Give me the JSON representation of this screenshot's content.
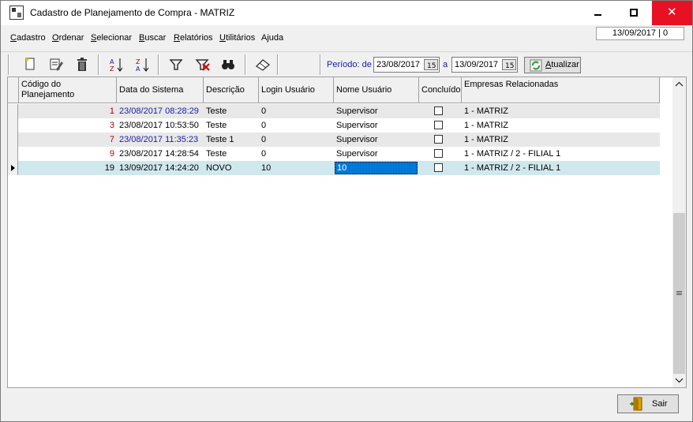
{
  "window": {
    "title": "Cadastro de Planejamento de Compra - MATRIZ",
    "icon": "app-icon",
    "close_glyph": "✕"
  },
  "menubar": {
    "items": [
      {
        "label_first": "C",
        "label_rest": "adastro"
      },
      {
        "label_first": "O",
        "label_rest": "rdenar"
      },
      {
        "label_first": "S",
        "label_rest": "elecionar"
      },
      {
        "label_first": "B",
        "label_rest": "uscar"
      },
      {
        "label_first": "R",
        "label_rest": "elatórios"
      },
      {
        "label_first": "U",
        "label_rest": "tilitários"
      },
      {
        "label_first": "",
        "label_rest": "Ajuda"
      }
    ],
    "status": "13/09/2017 | 0"
  },
  "toolbar": {
    "periodo_label": "Período: de",
    "date_from": "23/08/2017",
    "a_label": "a",
    "date_to": "13/09/2017",
    "atualizar_first": "A",
    "atualizar_rest": "tualizar"
  },
  "grid": {
    "headers": [
      "Código do Planejamento",
      "Data do Sistema",
      "Descrição",
      "Login Usuário",
      "Nome Usuário",
      "Concluído",
      "Empresas Relacionadas"
    ],
    "rows": [
      {
        "codigo": "1",
        "data": "23/08/2017 08:28:29",
        "descricao": "Teste",
        "login": "0",
        "nome": "Supervisor",
        "concluido": false,
        "empresas": "1 - MATRIZ",
        "bg": "#e8e8e8",
        "code_color": "#b00000",
        "date_color": "#1a1aa6"
      },
      {
        "codigo": "3",
        "data": "23/08/2017 10:53:50",
        "descricao": "Teste",
        "login": "0",
        "nome": "Supervisor",
        "concluido": false,
        "empresas": "1 - MATRIZ",
        "bg": "#ffffff",
        "code_color": "#b00000",
        "date_color": "#000000"
      },
      {
        "codigo": "7",
        "data": "23/08/2017 11:35:23",
        "descricao": "Teste 1",
        "login": "0",
        "nome": "Supervisor",
        "concluido": false,
        "empresas": "1 - MATRIZ",
        "bg": "#e8e8e8",
        "code_color": "#b00000",
        "date_color": "#1a1aa6"
      },
      {
        "codigo": "9",
        "data": "23/08/2017 14:28:54",
        "descricao": "Teste",
        "login": "0",
        "nome": "Supervisor",
        "concluido": false,
        "empresas": "1 - MATRIZ / 2 - FILIAL 1",
        "bg": "#ffffff",
        "code_color": "#b00000",
        "date_color": "#000000"
      },
      {
        "codigo": "19",
        "data": "13/09/2017 14:24:20",
        "descricao": "NOVO",
        "login": "10",
        "nome": "10",
        "concluido": false,
        "empresas": "1 - MATRIZ / 2 - FILIAL 1",
        "bg": "#cfe8ee",
        "code_color": "#000000",
        "date_color": "#000000",
        "current": true
      }
    ]
  },
  "footer": {
    "sair_label": "Sair"
  }
}
